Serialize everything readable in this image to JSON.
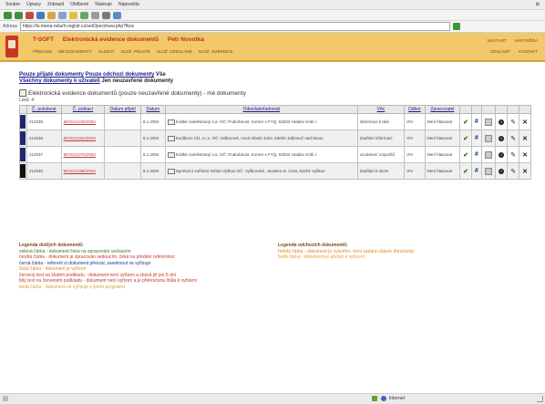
{
  "browser": {
    "menu": [
      "Soubor",
      "Úpravy",
      "Zobrazit",
      "Oblíbené",
      "Nástroje",
      "Nápověda"
    ],
    "address": "https://is.mena.nela/rt.registr.cz/setOpeci/new.php?fkce"
  },
  "app": {
    "title_left": "T-SOFT",
    "title_main": "Elektronická evidence dokumentů",
    "title_user": "Petr Novotka",
    "nav": [
      "PŘEHLED",
      "MÉ DOKUMENTY",
      "HLEDAT",
      "SLOŽ. PŘIJATÉ",
      "SLOŽ. ODESLANÉ",
      "SLOŽ. SMĚRNICE"
    ],
    "right_top": [
      "NASTAVIT",
      "NÁPOVĚDA"
    ],
    "right_bottom": [
      "ODHLÁSIT",
      "KONTAKT"
    ]
  },
  "filters": {
    "incoming": "Pouze přijaté dokumenty",
    "outgoing": "Pouze odchozí dokumenty",
    "all": "Vše",
    "user_docs": "Všechny dokumenty k uživateli",
    "unresolved": "Jen neuzavřené dokumenty"
  },
  "list_title": "Elektronická evidence dokumentů (pouze neuzavřené dokumenty) - mé dokumenty",
  "list_count": "Listů: 4",
  "table": {
    "headers": [
      "Č. položené",
      "Č. jednací",
      "Datum přijetí",
      "Datum",
      "Odesílatel/adresát",
      "Věc",
      "Odbor",
      "Zpracovatel",
      "",
      "",
      "",
      "",
      "",
      ""
    ],
    "rows": [
      {
        "color": "#1b2a6b",
        "id": "212035",
        "ref": "MOS/21345/2004",
        "date": "8.1.2004",
        "sender": "Krátké zaměstnaný s.a. OČ: Podrobnost. Korner s FYQ, 53202 Hradec Králi t.",
        "subject": "informace k akci",
        "dept": "VIV",
        "status": "Není hlasovat"
      },
      {
        "color": "#1b2a6b",
        "id": "212036",
        "ref": "MOS/21362/2004",
        "date": "8.1.2004",
        "sender": "Kudibovo CD, s.r.o. OČ: Odborové, nová 20x82 4322, 53002 Jabloneč nad Nisou",
        "subject": "Zasílání informací",
        "dept": "VIV",
        "status": "Není hlasovat"
      },
      {
        "color": "#1b2a6b",
        "id": "212037",
        "ref": "MOS/21375/2004",
        "date": "8.1.2004",
        "sender": "Krátké zaměstnaný s.a. OČ: Podrobnost. Korner s FYQ, 53202 Hradec Králi t.",
        "subject": "oznámení rozpočtů",
        "dept": "VIV",
        "status": "Není hlasovat"
      },
      {
        "color": "#111111",
        "id": "212040",
        "ref": "MOS/21386/2004",
        "date": "8.1.2004",
        "sender": "Sportovní zařízení města Vyškov OČ: Vyškovské, Jandera st. 2119, 52201 Vyškov",
        "subject": "Zasílání k úloze",
        "dept": "VIV",
        "status": "Není hlasovat"
      }
    ]
  },
  "legend_left": {
    "title": "Legenda došlých dokumentů:",
    "lines": [
      "zelená čárka - dokument čeká na zpracování vedoucím",
      "modrá čárka - dokument je zpracován vedoucím, čeká na předání referentovi",
      "černá čárka - referent si dokument převzal, zaseknout se vyřizuje",
      "žlutá čárka - dokument je vyřízen",
      "červený text na žlutém podkladu - dokument není vyřízen a zbývá již jen 5 dní",
      "bílý text na červeném podkladu - dokument není vyřízen a je překročena lhůta k vyřízení",
      "šedá čárka - dokument se vyřizuje v jiném programu"
    ]
  },
  "legend_right": {
    "title": "Legenda odchozích dokumentů:",
    "lines": [
      "hnědá čárka - dokument je vytvořen, není zadáno datum doručenky",
      "šedá čárka - dokument je uložen k vyřízení"
    ]
  },
  "status": {
    "zone": "Internet"
  },
  "colors": {
    "header_bg": "#f3c86a",
    "accent": "#b33322",
    "link": "#1a1a8a",
    "legend_red": "#c0392b",
    "legend_orange": "#e08a1a",
    "legend_blue": "#1a3a8a",
    "legend_green": "#3a7a1a",
    "legend_gray": "#8a8a8a"
  }
}
